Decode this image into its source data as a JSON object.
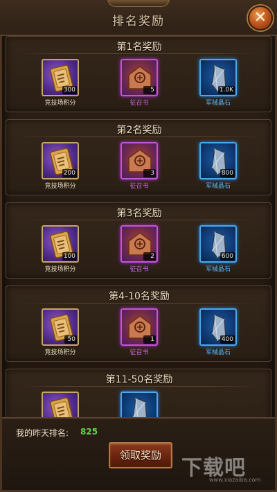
{
  "dialog": {
    "title": "排名奖励",
    "close_label": "✕"
  },
  "sections": [
    {
      "title": "第1名奖励",
      "items": [
        {
          "type": "gold",
          "icon": "arena-token-icon",
          "qty": "300",
          "label": "竞技场积分"
        },
        {
          "type": "purple",
          "icon": "recruit-book-icon",
          "qty": "5",
          "label": "征召书"
        },
        {
          "type": "blue",
          "icon": "crystal-icon",
          "qty": "1.0K",
          "label": "军械晶石"
        }
      ]
    },
    {
      "title": "第2名奖励",
      "items": [
        {
          "type": "gold",
          "icon": "arena-token-icon",
          "qty": "200",
          "label": "竞技场积分"
        },
        {
          "type": "purple",
          "icon": "recruit-book-icon",
          "qty": "3",
          "label": "征召书"
        },
        {
          "type": "blue",
          "icon": "crystal-icon",
          "qty": "800",
          "label": "军械晶石"
        }
      ]
    },
    {
      "title": "第3名奖励",
      "items": [
        {
          "type": "gold",
          "icon": "arena-token-icon",
          "qty": "100",
          "label": "竞技场积分"
        },
        {
          "type": "purple",
          "icon": "recruit-book-icon",
          "qty": "2",
          "label": "征召书"
        },
        {
          "type": "blue",
          "icon": "crystal-icon",
          "qty": "600",
          "label": "军械晶石"
        }
      ]
    },
    {
      "title": "第4-10名奖励",
      "items": [
        {
          "type": "gold",
          "icon": "arena-token-icon",
          "qty": "50",
          "label": "竞技场积分"
        },
        {
          "type": "purple",
          "icon": "recruit-book-icon",
          "qty": "1",
          "label": "征召书"
        },
        {
          "type": "blue",
          "icon": "crystal-icon",
          "qty": "400",
          "label": "军械晶石"
        }
      ]
    },
    {
      "title": "第11-50名奖励",
      "items": [
        {
          "type": "gold",
          "icon": "arena-token-icon",
          "qty": "",
          "label": ""
        },
        {
          "type": "blue",
          "icon": "crystal-icon",
          "qty": "",
          "label": ""
        }
      ]
    }
  ],
  "footer": {
    "rank_label": "我的昨天排名:",
    "rank_value": "825",
    "claim_button": "领取奖励"
  },
  "watermark": {
    "big": "下载吧",
    "small": "www.xiazaiba.com"
  },
  "colors": {
    "accent_green": "#5fd64a",
    "purple_label": "#d068e6",
    "blue_label": "#58b0f0"
  }
}
